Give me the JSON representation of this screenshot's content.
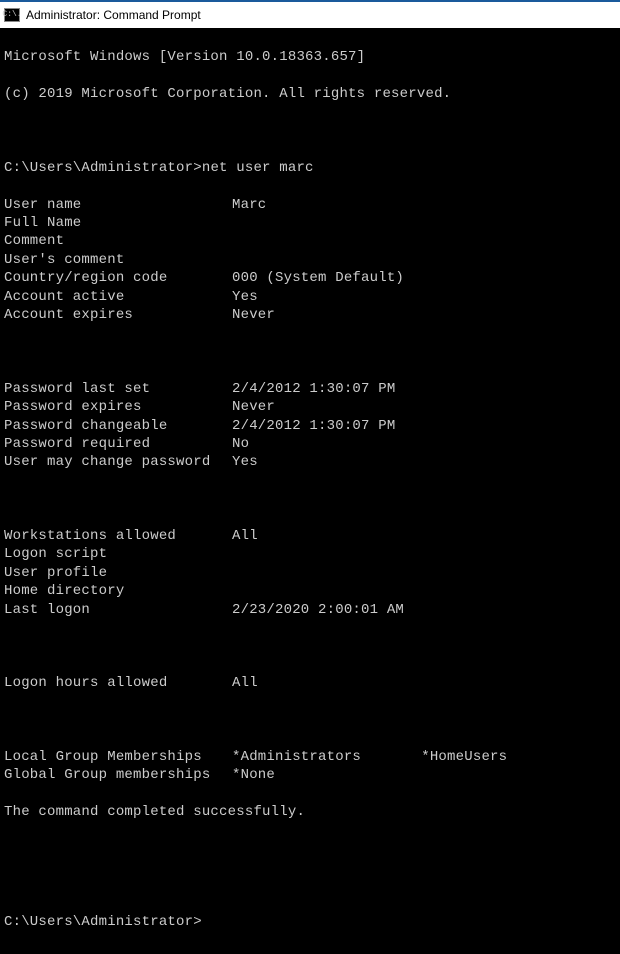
{
  "window": {
    "title": "Administrator: Command Prompt",
    "icon_glyph": "C:\\."
  },
  "session": {
    "banner1": "Microsoft Windows [Version 10.0.18363.657]",
    "banner2": "(c) 2019 Microsoft Corporation. All rights reserved.",
    "prompt1_path": "C:\\Users\\Administrator>",
    "prompt1_cmd": "net user marc",
    "prompt2_path": "C:\\Users\\Administrator>"
  },
  "output": {
    "sec1": [
      {
        "label": "User name",
        "value": "Marc"
      },
      {
        "label": "Full Name",
        "value": ""
      },
      {
        "label": "Comment",
        "value": ""
      },
      {
        "label": "User's comment",
        "value": ""
      },
      {
        "label": "Country/region code",
        "value": "000 (System Default)"
      },
      {
        "label": "Account active",
        "value": "Yes"
      },
      {
        "label": "Account expires",
        "value": "Never"
      }
    ],
    "sec2": [
      {
        "label": "Password last set",
        "value": "‎2/‎4/‎2012 1:30:07 PM"
      },
      {
        "label": "Password expires",
        "value": "Never"
      },
      {
        "label": "Password changeable",
        "value": "‎2/‎4/‎2012 1:30:07 PM"
      },
      {
        "label": "Password required",
        "value": "No"
      },
      {
        "label": "User may change password",
        "value": "Yes"
      }
    ],
    "sec3": [
      {
        "label": "Workstations allowed",
        "value": "All"
      },
      {
        "label": "Logon script",
        "value": ""
      },
      {
        "label": "User profile",
        "value": ""
      },
      {
        "label": "Home directory",
        "value": ""
      },
      {
        "label": "Last logon",
        "value": "‎2/‎23/‎2020 2:00:01 AM"
      }
    ],
    "sec4": [
      {
        "label": "Logon hours allowed",
        "value": "All"
      }
    ],
    "sec5": [
      {
        "label": "Local Group Memberships",
        "value": "*Administrators       *HomeUsers"
      },
      {
        "label": "Global Group memberships",
        "value": "*None"
      }
    ],
    "completion": "The command completed successfully."
  }
}
